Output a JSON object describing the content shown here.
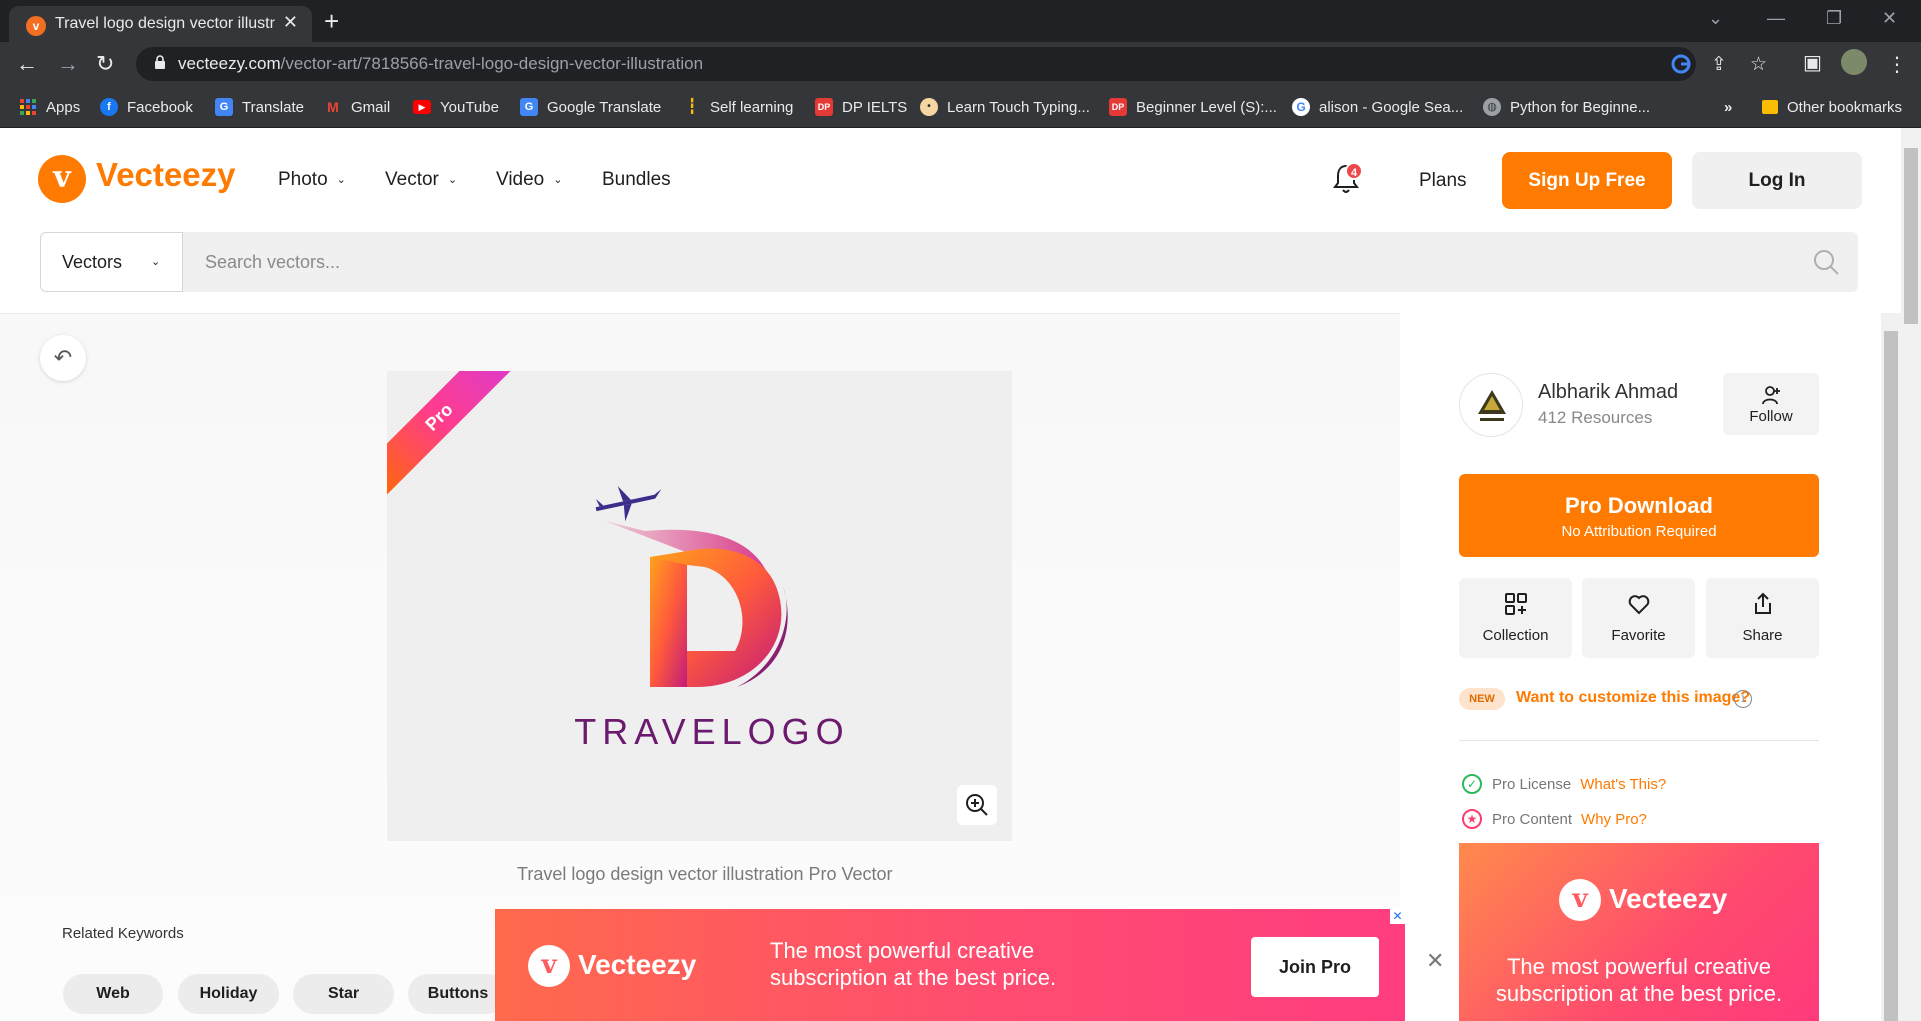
{
  "browser": {
    "tab_title": "Travel logo design vector illustrati",
    "url_host": "vecteezy.com",
    "url_path": "/vector-art/7818566-travel-logo-design-vector-illustration",
    "bookmarks": [
      {
        "label": "Apps",
        "icon": "apps-grid-icon",
        "color": "#ea4335"
      },
      {
        "label": "Facebook",
        "icon": "facebook-icon",
        "color": "#1877f2"
      },
      {
        "label": "Translate",
        "icon": "google-translate-icon",
        "color": "#4285f4"
      },
      {
        "label": "Gmail",
        "icon": "gmail-icon",
        "color": "#ea4335"
      },
      {
        "label": "YouTube",
        "icon": "youtube-icon",
        "color": "#ff0000"
      },
      {
        "label": "Google Translate",
        "icon": "google-translate-icon",
        "color": "#4285f4"
      },
      {
        "label": "Self learning",
        "icon": "bars-icon",
        "color": "#fbbc04"
      },
      {
        "label": "DP IELTS",
        "icon": "dp-icon",
        "color": "#e53935"
      },
      {
        "label": "Learn Touch Typing...",
        "icon": "typing-icon",
        "color": "#333333"
      },
      {
        "label": "Beginner Level (S):...",
        "icon": "dp-icon",
        "color": "#e53935"
      },
      {
        "label": "alison - Google Sea...",
        "icon": "google-icon",
        "color": "#ffffff"
      },
      {
        "label": "Python for Beginne...",
        "icon": "globe-icon",
        "color": "#9aa0a6"
      }
    ],
    "more_bookmarks": "»",
    "other_bookmarks": "Other bookmarks"
  },
  "header": {
    "logo_text": "Vecteezy",
    "nav": [
      "Photo",
      "Vector",
      "Video",
      "Bundles"
    ],
    "notification_count": "4",
    "plans": "Plans",
    "signup": "Sign Up Free",
    "login": "Log In"
  },
  "search": {
    "type": "Vectors",
    "placeholder": "Search vectors..."
  },
  "preview": {
    "badge": "Pro",
    "logo_wordmark": "TRAVELOGO",
    "caption": "Travel logo design vector illustration Pro Vector"
  },
  "related": {
    "title": "Related Keywords",
    "keywords": [
      "Web",
      "Holiday",
      "Star",
      "Buttons"
    ]
  },
  "sidebar": {
    "author_name": "Albharik Ahmad",
    "author_resources": "412 Resources",
    "follow": "Follow",
    "pro_download": "Pro Download",
    "pro_download_sub": "No Attribution Required",
    "actions": [
      "Collection",
      "Favorite",
      "Share"
    ],
    "new_badge": "NEW",
    "customize": "Want to customize this image?",
    "license_label": "Pro License",
    "license_link": "What's This?",
    "content_label": "Pro Content",
    "content_link": "Why Pro?"
  },
  "ads": {
    "brand": "Vecteezy",
    "bottom_text": "The most powerful creative subscription at the best price.",
    "join": "Join Pro",
    "side_text": "The most powerful creative subscription at the best price."
  },
  "colors": {
    "brand_orange": "#ff7a00",
    "chrome_dark": "#202124",
    "chrome_mid": "#35363a"
  }
}
